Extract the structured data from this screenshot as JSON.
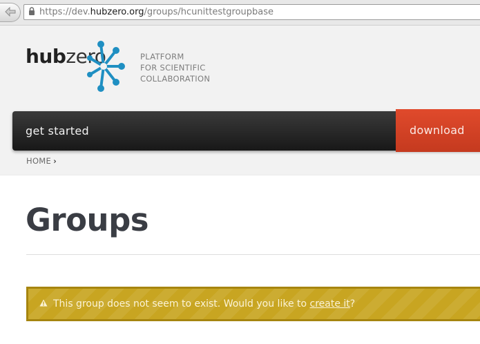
{
  "browser": {
    "url_prefix": "https://dev.",
    "url_host": "hubzero.org",
    "url_path": "/groups/hcunittestgroupbase"
  },
  "logo": {
    "hub": "hub",
    "zero": "zero"
  },
  "tagline": [
    "PLATFORM",
    "FOR SCIENTIFIC",
    "COLLABORATION"
  ],
  "nav": {
    "get_started": "get started",
    "download": "download"
  },
  "breadcrumb": {
    "home": "HOME",
    "separator": "›"
  },
  "page_title": "Groups",
  "warning": {
    "text_before": "This group does not seem to exist. Would you like to",
    "link": "create it",
    "text_after": "?"
  },
  "colors": {
    "accent_blue": "#1f8fc2",
    "download_red": "#d8432a",
    "warning_gold": "#c8a521",
    "nav_dark": "#222222"
  }
}
